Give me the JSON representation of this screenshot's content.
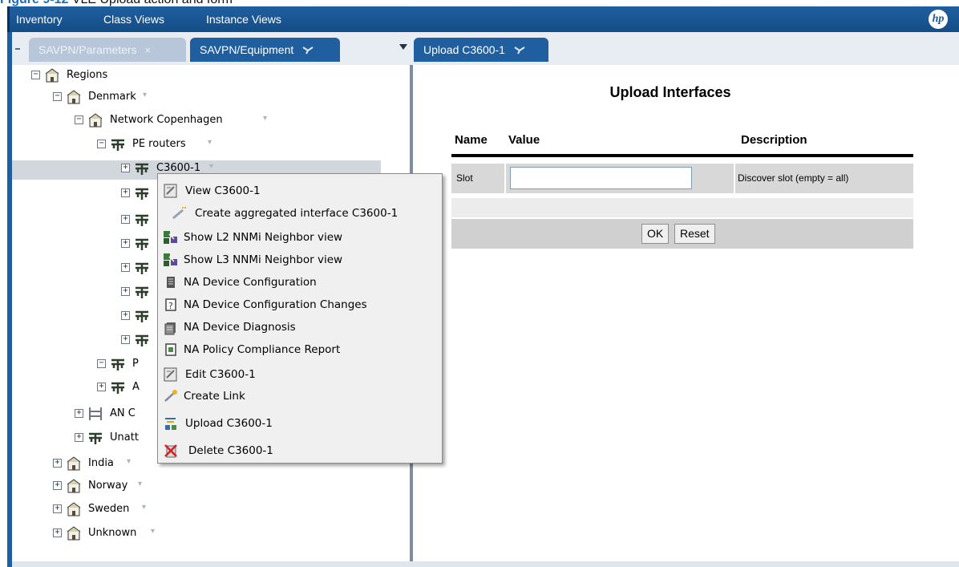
{
  "caption": {
    "figure_label": "Figure 9-12",
    "text": "VLE Upload action and form"
  },
  "menubar": {
    "items": [
      "Inventory",
      "Class Views",
      "Instance Views"
    ],
    "logo_text": "hp"
  },
  "tabs": [
    {
      "label": "SAVPN/Parameters",
      "close": "×",
      "state": "inactive"
    },
    {
      "label": "SAVPN/Equipment",
      "state": "active"
    },
    {
      "label": "Upload C3600-1",
      "state": "active"
    }
  ],
  "tree": {
    "regions": "Regions",
    "denmark": "Denmark",
    "network_copenhagen": "Network Copenhagen",
    "pe_routers": "PE routers",
    "c3600": "C3600-1",
    "p_partial": "P",
    "a_partial": "A",
    "an_partial": "AN C",
    "unatt_partial": "Unatt",
    "india": "India",
    "norway": "Norway",
    "sweden": "Sweden",
    "unknown": "Unknown"
  },
  "context_menu": {
    "items": [
      "View C3600-1",
      "Create aggregated interface C3600-1",
      "Show L2 NNMi Neighbor view",
      "Show L3 NNMi Neighbor view",
      "NA Device Configuration",
      "NA Device Configuration Changes",
      "NA Device Diagnosis",
      "NA Policy Compliance Report",
      "Edit C3600-1",
      "Create Link",
      "Upload C3600-1",
      "Delete C3600-1"
    ]
  },
  "form": {
    "title": "Upload Interfaces",
    "columns": [
      "Name",
      "Value",
      "Description"
    ],
    "row": {
      "name": "Slot",
      "value": "",
      "description": "Discover slot (empty = all)"
    },
    "ok_label": "OK",
    "reset_label": "Reset"
  },
  "colors": {
    "brand_blue": "#1f5fa0",
    "selected_row": "#d2d7de"
  }
}
